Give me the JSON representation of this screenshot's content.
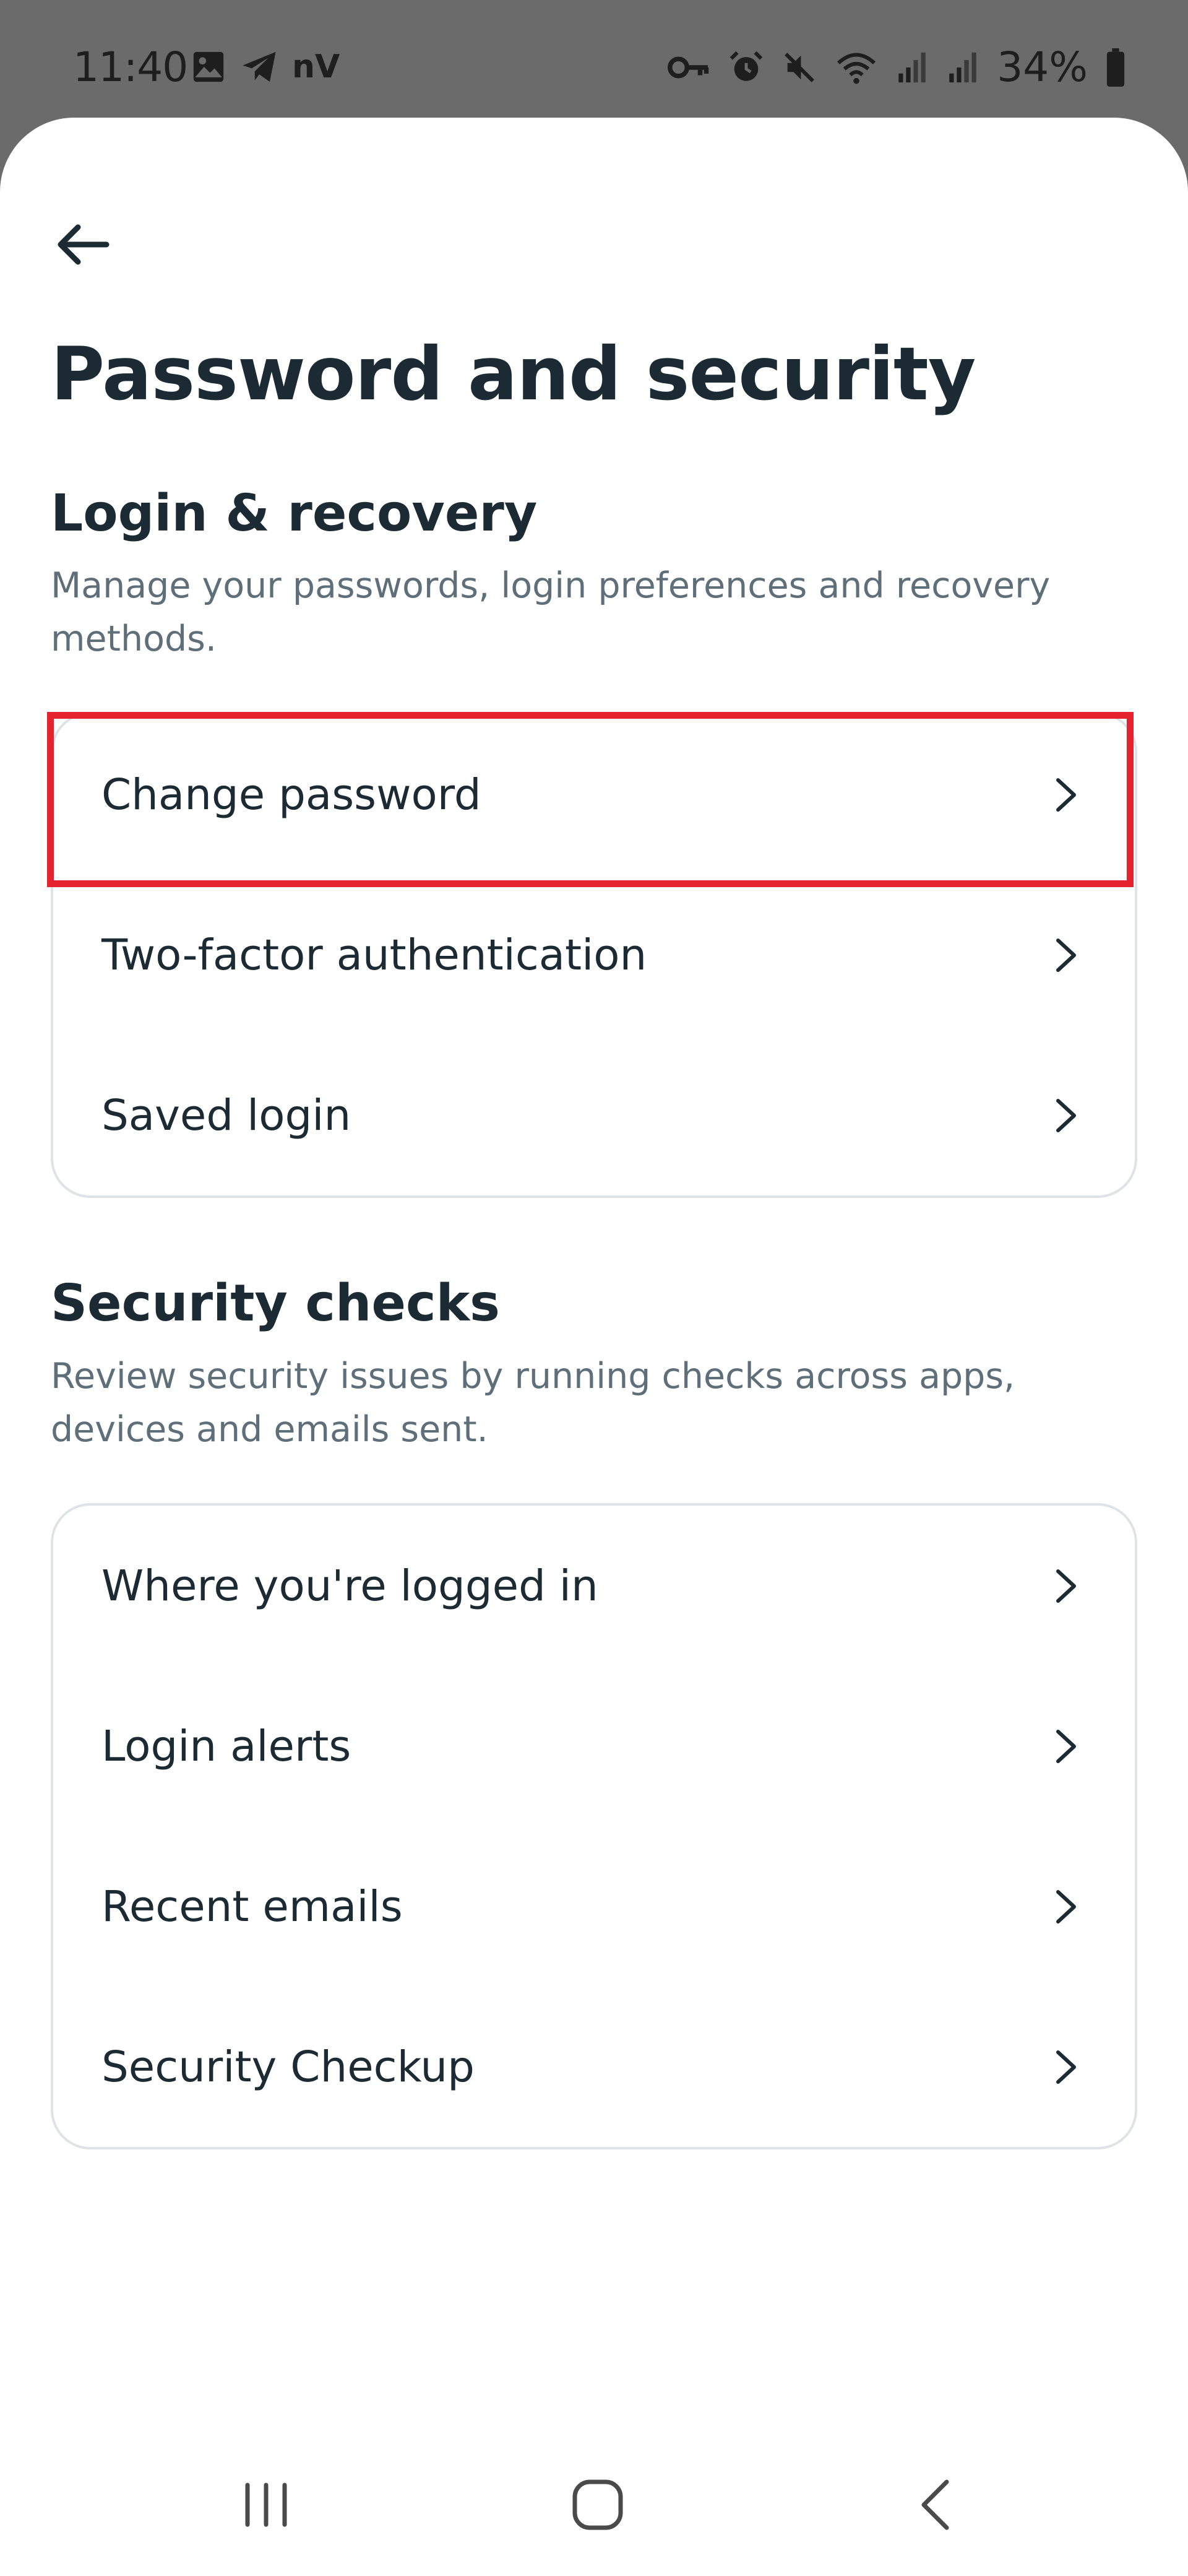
{
  "status_bar": {
    "time": "11:40",
    "carrier_badge": "nV",
    "battery_percent": "34%"
  },
  "header": {
    "title": "Password and security"
  },
  "login_recovery": {
    "title": "Login & recovery",
    "description": "Manage your passwords, login preferences and recovery methods.",
    "items": [
      {
        "label": "Change password"
      },
      {
        "label": "Two-factor authentication"
      },
      {
        "label": "Saved login"
      }
    ]
  },
  "security_checks": {
    "title": "Security checks",
    "description": "Review security issues by running checks across apps, devices and emails sent.",
    "items": [
      {
        "label": "Where you're logged in"
      },
      {
        "label": "Login alerts"
      },
      {
        "label": "Recent emails"
      },
      {
        "label": "Security Checkup"
      }
    ]
  },
  "highlight_color": "#e5232f",
  "nav": {
    "icons": [
      "recent-apps-icon",
      "home-icon",
      "back-icon"
    ]
  }
}
